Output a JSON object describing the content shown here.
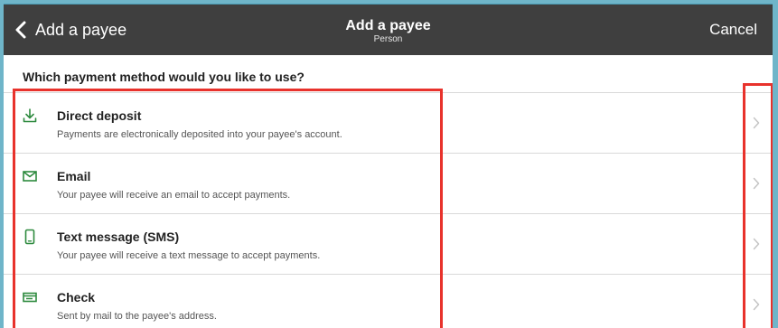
{
  "header": {
    "back_label": "Add a payee",
    "title": "Add a payee",
    "subtitle": "Person",
    "cancel_label": "Cancel"
  },
  "question": "Which payment method would you like to use?",
  "payment_methods": [
    {
      "title": "Direct deposit",
      "description": "Payments are electronically deposited into your payee's account.",
      "icon": "download-icon"
    },
    {
      "title": "Email",
      "description": "Your payee will receive an email to accept payments.",
      "icon": "envelope-icon"
    },
    {
      "title": "Text message (SMS)",
      "description": "Your payee will receive a text message to accept payments.",
      "icon": "phone-icon"
    },
    {
      "title": "Check",
      "description": "Sent by mail to the payee's address.",
      "icon": "check-card-icon"
    }
  ],
  "colors": {
    "header_bg": "#3f3f3f",
    "icon_green": "#2d8a3e",
    "highlight_red": "#e8322c",
    "page_border": "#6fb5c9"
  }
}
